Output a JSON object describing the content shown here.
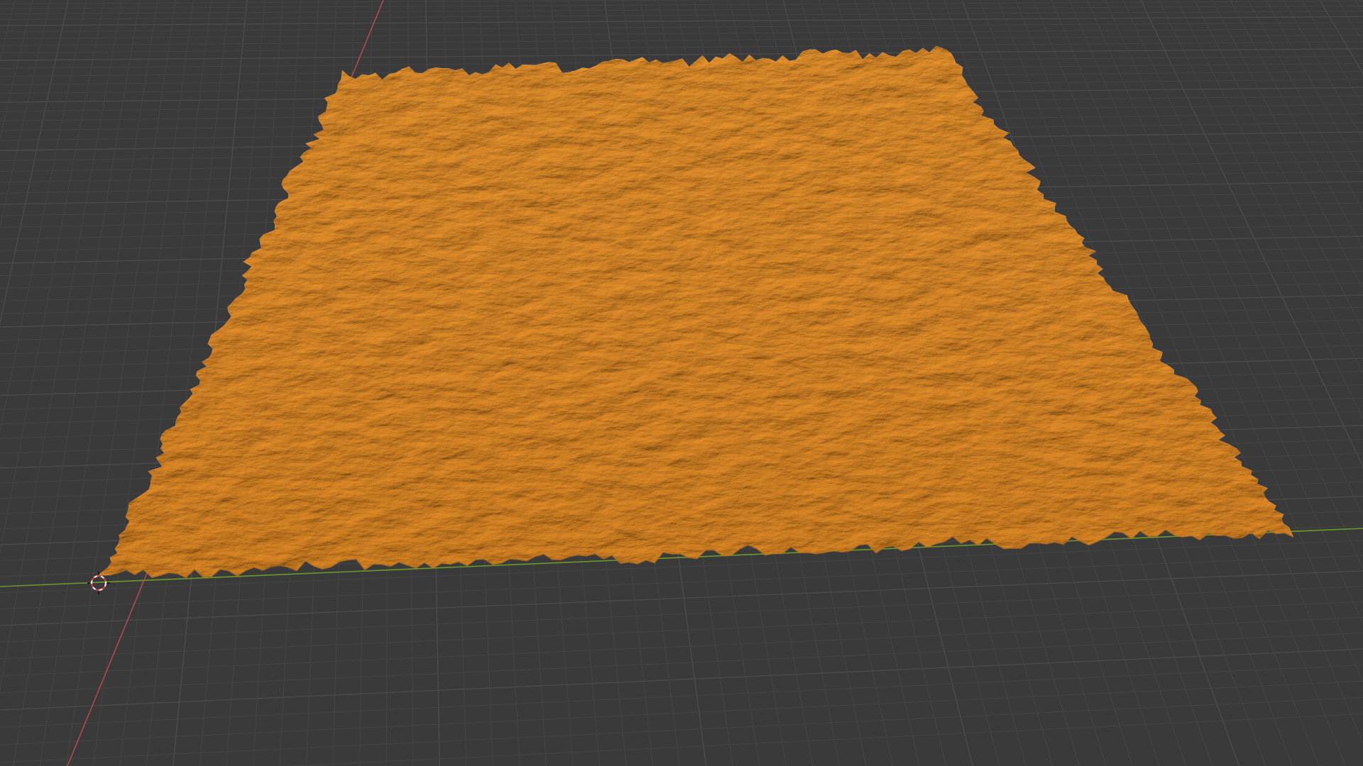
{
  "viewport": {
    "view": "perspective",
    "background_color": "#3a3a3a",
    "grid_minor_color": "#454545",
    "grid_major_color": "#4c4c4c",
    "x_axis_color": "#c14b53",
    "y_axis_color": "#6b9a2a",
    "origin_label": "",
    "overlays_visible": false
  },
  "scene_object": {
    "type": "mesh",
    "description_shown": "",
    "shading": "solid",
    "color": "#f0962d",
    "shadow_color": "#b56a16",
    "selected": false
  },
  "cursor_3d": {
    "visible": true,
    "ring_color_a": "#e8e8e8",
    "ring_color_b": "#d43c3c"
  }
}
